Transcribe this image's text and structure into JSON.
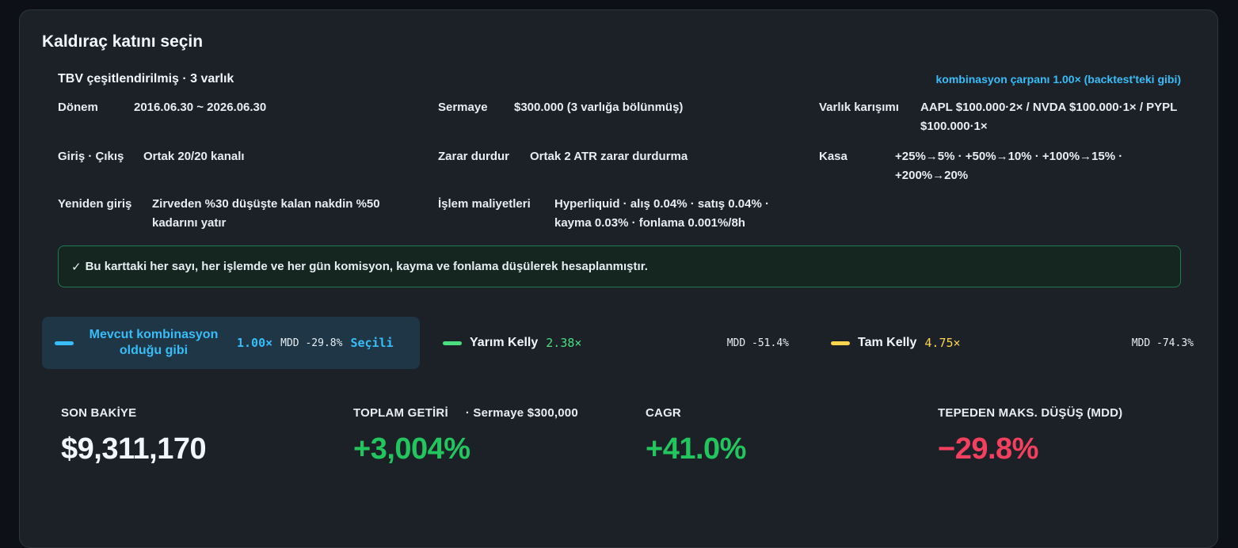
{
  "card": {
    "title": "Kaldıraç katını seçin",
    "strategy": "TBV çeşitlendirilmiş · 3 varlık",
    "combo_note": "kombinasyon çarpanı 1.00× (backtest'teki gibi)"
  },
  "fields": {
    "period": {
      "label": "Dönem",
      "value": "2016.06.30 ~ 2026.06.30"
    },
    "capital": {
      "label": "Sermaye",
      "value": "$300.000 (3 varlığa bölünmüş)"
    },
    "mix": {
      "label": "Varlık karışımı",
      "value": "AAPL $100.000·2× / NVDA $100.000·1× / PYPL $100.000·1×"
    },
    "entry_exit": {
      "label": "Giriş · Çıkış",
      "value": "Ortak 20/20 kanalı"
    },
    "stop": {
      "label": "Zarar durdur",
      "value": "Ortak 2 ATR zarar durdurma"
    },
    "vault": {
      "label": "Kasa",
      "value": "+25%→5% · +50%→10% · +100%→15% · +200%→20%"
    },
    "reentry": {
      "label": "Yeniden giriş",
      "value": "Zirveden %30 düşüşte kalan nakdin %50 kadarını yatır"
    },
    "costs": {
      "label": "İşlem maliyetleri",
      "value": "Hyperliquid · alış 0.04% · satış 0.04% · kayma 0.03% · fonlama 0.001%/8h"
    }
  },
  "notice": {
    "icon": "check-icon",
    "text": "Bu karttaki her sayı, her işlemde ve her gün komisyon, kayma ve fonlama düşülerek hesaplanmıştır."
  },
  "options": [
    {
      "name": "Mevcut kombinasyon olduğu gibi",
      "multiplier": "1.00×",
      "mdd": "MDD -29.8%",
      "selected_label": "Seçili",
      "color": "#38bdf8"
    },
    {
      "name": "Yarım Kelly",
      "multiplier": "2.38×",
      "mdd": "MDD -51.4%",
      "color": "#4ade80"
    },
    {
      "name": "Tam Kelly",
      "multiplier": "4.75×",
      "mdd": "MDD -74.3%",
      "color": "#fcd34d"
    }
  ],
  "metrics": {
    "balance": {
      "label": "SON BAKİYE",
      "value": "$9,311,170",
      "color": "#f0f6fc"
    },
    "total_return": {
      "label": "TOPLAM GETİRİ",
      "sub": "· Sermaye $300,000",
      "value": "+3,004%",
      "color": "#22c55e"
    },
    "cagr": {
      "label": "CAGR",
      "value": "+41.0%",
      "color": "#22c55e"
    },
    "mdd": {
      "label": "TEPEDEN MAKS. DÜŞÜŞ (MDD)",
      "value": "−29.8%",
      "color": "#f43f5e"
    }
  }
}
